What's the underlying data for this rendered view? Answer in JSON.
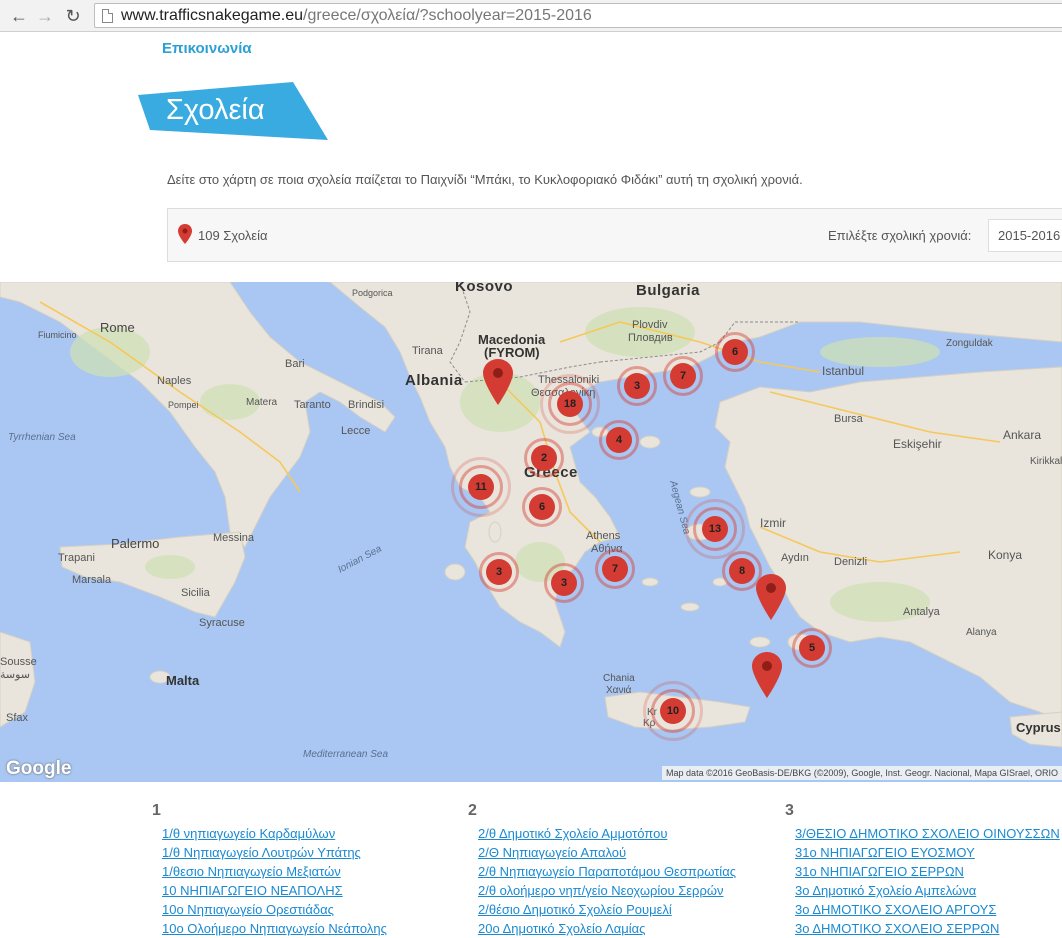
{
  "browser": {
    "url_domain": "www.trafficsnakegame.eu",
    "url_path": "/greece/σχολεία/?schoolyear=2015-2016",
    "back_icon": "arrow-left-icon",
    "forward_icon": "arrow-right-icon",
    "reload_icon": "reload-icon"
  },
  "nav": {
    "contact": "Επικοινωνία"
  },
  "header": {
    "title": "Σχολεία",
    "accent_color": "#3aabe0"
  },
  "intro": "Δείτε στο χάρτη σε ποια σχολεία παίζεται το Παιχνίδι “Μπάκι, το Κυκλοφοριακό Φιδάκι” αυτή τη σχολική χρονιά.",
  "filter": {
    "count_label": "109 Σχολεία",
    "year_label": "Επιλέξτε σχολική χρονιά:",
    "year_value": "2015-2016"
  },
  "map": {
    "labels": [
      {
        "text": "Kosovo",
        "cls": "country"
      },
      {
        "text": "Podgorica",
        "cls": ""
      },
      {
        "text": "Bulgaria",
        "cls": "country"
      },
      {
        "text": "Rome",
        "cls": "big"
      },
      {
        "text": "Fiumicino",
        "cls": ""
      },
      {
        "text": "Macedonia",
        "cls": "big"
      },
      {
        "text": "(FYROM)",
        "cls": "big"
      },
      {
        "text": "Tirana",
        "cls": ""
      },
      {
        "text": "Albania",
        "cls": "country"
      },
      {
        "text": "Plovdiv",
        "cls": ""
      },
      {
        "text": "Пловдив",
        "cls": ""
      },
      {
        "text": "Bari",
        "cls": ""
      },
      {
        "text": "Naples",
        "cls": ""
      },
      {
        "text": "Pompei",
        "cls": ""
      },
      {
        "text": "Matera",
        "cls": ""
      },
      {
        "text": "Taranto",
        "cls": ""
      },
      {
        "text": "Brindisi",
        "cls": ""
      },
      {
        "text": "Lecce",
        "cls": ""
      },
      {
        "text": "Thessaloniki",
        "cls": ""
      },
      {
        "text": "Θεσσαλονίκη",
        "cls": ""
      },
      {
        "text": "Istanbul",
        "cls": ""
      },
      {
        "text": "Zonguldak",
        "cls": ""
      },
      {
        "text": "Bursa",
        "cls": ""
      },
      {
        "text": "Eskişehir",
        "cls": ""
      },
      {
        "text": "Ankara",
        "cls": ""
      },
      {
        "text": "Kirikkale",
        "cls": ""
      },
      {
        "text": "Tyrrhenian Sea",
        "cls": "sea"
      },
      {
        "text": "Greece",
        "cls": "country"
      },
      {
        "text": "Aegean Sea",
        "cls": "sea"
      },
      {
        "text": "Izmir",
        "cls": ""
      },
      {
        "text": "Palermo",
        "cls": "big"
      },
      {
        "text": "Messina",
        "cls": ""
      },
      {
        "text": "Ionian Sea",
        "cls": "sea"
      },
      {
        "text": "Trapani",
        "cls": ""
      },
      {
        "text": "Marsala",
        "cls": ""
      },
      {
        "text": "Sicilia",
        "cls": ""
      },
      {
        "text": "Syracuse",
        "cls": ""
      },
      {
        "text": "Athens",
        "cls": ""
      },
      {
        "text": "Αθήνα",
        "cls": ""
      },
      {
        "text": "Aydın",
        "cls": ""
      },
      {
        "text": "Denizli",
        "cls": ""
      },
      {
        "text": "Konya",
        "cls": ""
      },
      {
        "text": "Antalya",
        "cls": ""
      },
      {
        "text": "Alanya",
        "cls": ""
      },
      {
        "text": "Malta",
        "cls": "big"
      },
      {
        "text": "Sousse",
        "cls": ""
      },
      {
        "text": "سوسة",
        "cls": ""
      },
      {
        "text": "Sfax",
        "cls": ""
      },
      {
        "text": "Chania",
        "cls": ""
      },
      {
        "text": "Χανιά",
        "cls": ""
      },
      {
        "text": "Mediterranean Sea",
        "cls": "sea"
      },
      {
        "text": "Cyprus",
        "cls": "big"
      },
      {
        "text": "Kr",
        "cls": ""
      },
      {
        "text": "Κρ",
        "cls": ""
      }
    ],
    "clusters": [
      {
        "n": "18"
      },
      {
        "n": "3"
      },
      {
        "n": "7"
      },
      {
        "n": "6"
      },
      {
        "n": "4"
      },
      {
        "n": "2"
      },
      {
        "n": "11"
      },
      {
        "n": "6"
      },
      {
        "n": "13"
      },
      {
        "n": "3"
      },
      {
        "n": "3"
      },
      {
        "n": "7"
      },
      {
        "n": "8"
      },
      {
        "n": "5"
      },
      {
        "n": "10"
      }
    ],
    "google_logo": "Google",
    "attribution": "Map data ©2016 GeoBasis-DE/BKG (©2009), Google, Inst. Geogr. Nacional, Mapa GISrael, ORIO",
    "water_color": "#a9c7f2",
    "land_color": "#e9e5dc",
    "marker_color": "#d43b32"
  },
  "columns": [
    {
      "heading": "1",
      "items": [
        "1/θ νηπιαγωγείο Καρδαμύλων",
        "1/θ Νηπιαγωγείο Λουτρών Υπάτης",
        "1/θεσιο Νηπιαγωγείο Μεξιατών",
        "10 ΝΗΠΙΑΓΩΓΕΙΟ ΝΕΑΠΟΛΗΣ",
        "10ο Νηπιαγωγείο Ορεστιάδας",
        "10ο Ολοήμερο Νηπιαγωγείο Νεάπολης"
      ]
    },
    {
      "heading": "2",
      "items": [
        "2/θ Δημοτικό Σχολείο Αμμοτόπου",
        "2/Θ Νηπιαγωγείο Απαλού",
        "2/θ Νηπιαγωγείο Παραποτάμου Θεσπρωτίας",
        "2/θ ολοήμερο νηπ/γείο Νεοχωρίου Σερρών",
        "2/θέσιο Δημοτικό Σχολείο Ρουμελί",
        "20ο Δημοτικό Σχολείο Λαμίας"
      ]
    },
    {
      "heading": "3",
      "items": [
        "3/ΘΕΣΙΟ ΔΗΜΟΤΙΚΟ ΣΧΟΛΕΙΟ ΟΙΝΟΥΣΣΩΝ",
        "31ο ΝΗΠΙΑΓΩΓΕΙΟ ΕΥΟΣΜΟΥ",
        "31ο ΝΗΠΙΑΓΩΓΕΙΟ ΣΕΡΡΩΝ",
        "3ο Δημοτικό Σχολείο Αμπελώνα",
        "3ο ΔΗΜΟΤΙΚΟ ΣΧΟΛΕΙΟ ΑΡΓΟΥΣ",
        "3ο ΔΗΜΟΤΙΚΟ ΣΧΟΛΕΙΟ ΣΕΡΡΩΝ"
      ]
    }
  ]
}
